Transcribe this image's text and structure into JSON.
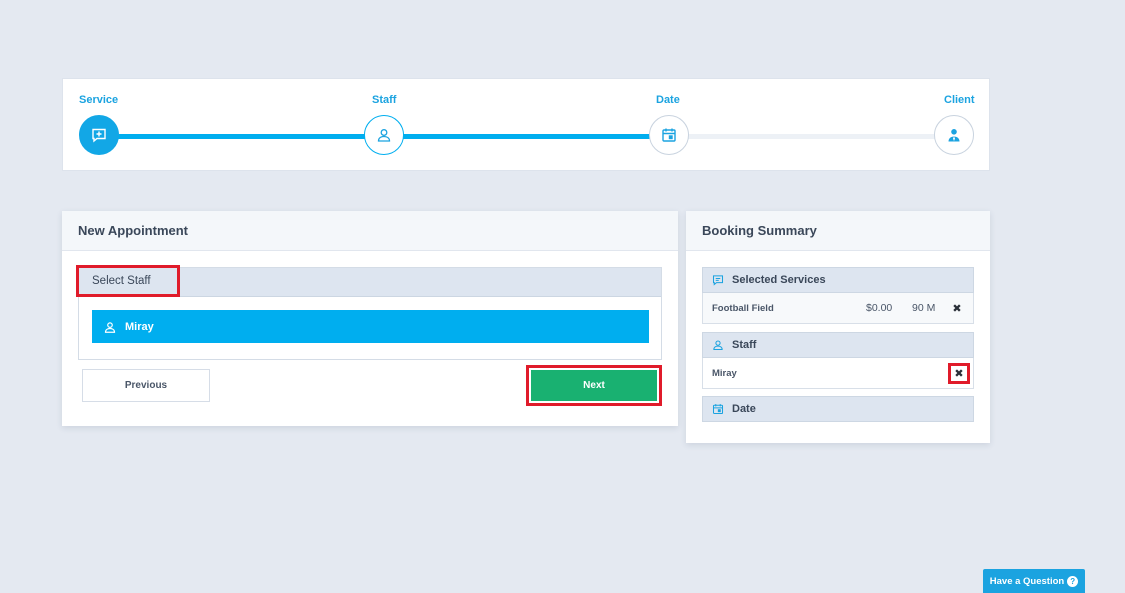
{
  "stepper": {
    "steps": [
      {
        "label": "Service",
        "icon": "chat-plus-icon",
        "state": "active"
      },
      {
        "label": "Staff",
        "icon": "user-icon",
        "state": "done"
      },
      {
        "label": "Date",
        "icon": "calendar-icon",
        "state": "pending"
      },
      {
        "label": "Client",
        "icon": "client-icon",
        "state": "pending"
      }
    ],
    "accent": "#00aeef"
  },
  "appointment": {
    "title": "New Appointment",
    "select_staff_label": "Select Staff",
    "staff": [
      {
        "name": "Miray",
        "selected": true
      }
    ],
    "previous_label": "Previous",
    "next_label": "Next"
  },
  "summary": {
    "title": "Booking Summary",
    "services_label": "Selected Services",
    "services": [
      {
        "name": "Football Field",
        "price": "$0.00",
        "duration": "90 M"
      }
    ],
    "staff_label": "Staff",
    "staff_name": "Miray",
    "date_label": "Date",
    "remove_glyph": "✖"
  },
  "help": {
    "label": "Have a Question",
    "glyph": "?"
  },
  "colors": {
    "primary": "#00aeef",
    "next": "#19b171",
    "highlight": "#e01b2a"
  }
}
